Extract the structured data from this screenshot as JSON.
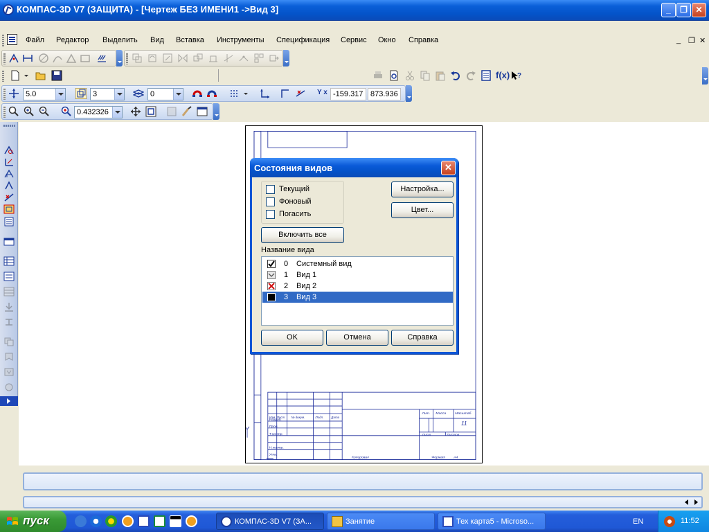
{
  "window": {
    "title": "КОМПАС-3D V7 (ЗАЩИТА) - [Чертеж БЕЗ ИМЕНИ1 ->Вид 3]",
    "minimize": "_",
    "maximize": "❐",
    "close": "✕"
  },
  "menu": {
    "items": [
      "Файл",
      "Редактор",
      "Выделить",
      "Вид",
      "Вставка",
      "Инструменты",
      "Спецификация",
      "Сервис",
      "Окно",
      "Справка"
    ],
    "mdi_minimize": "_",
    "mdi_restore": "❐",
    "mdi_close": "✕"
  },
  "toolbar": {
    "step": "5.0",
    "layer": "3",
    "style_index": "0",
    "coord_x": "-159.317",
    "coord_y": "873.936",
    "coord_label": "Y x",
    "zoom": "0.432326",
    "fx_label": "f(x)"
  },
  "drawing": {
    "sheet_number": "11",
    "format_label": "Формат",
    "format_value": "A4",
    "copied_label": "Копировал"
  },
  "dialog": {
    "title": "Состояния видов",
    "close": "✕",
    "options": [
      {
        "label": "Текущий",
        "checked": false
      },
      {
        "label": "Фоновый",
        "checked": false
      },
      {
        "label": "Погасить",
        "checked": false
      }
    ],
    "settings_button": "Настройка...",
    "color_button": "Цвет...",
    "enable_all_button": "Включить все",
    "list_header": "Название вида",
    "views": [
      {
        "num": "0",
        "name": "Системный вид",
        "state": "visible",
        "selected": false
      },
      {
        "num": "1",
        "name": "Вид 1",
        "state": "background",
        "selected": false
      },
      {
        "num": "2",
        "name": "Вид 2",
        "state": "hidden",
        "selected": false
      },
      {
        "num": "3",
        "name": "Вид 3",
        "state": "current",
        "selected": true
      }
    ],
    "ok_button": "OK",
    "cancel_button": "Отмена",
    "help_button": "Справка"
  },
  "taskbar": {
    "start_label": "пуск",
    "tasks": [
      {
        "label": "КОМПАС-3D V7 (ЗА...",
        "active": true
      },
      {
        "label": "Занятие",
        "active": false
      },
      {
        "label": "Тех карта5 - Microso...",
        "active": false
      }
    ],
    "language": "EN",
    "clock": "11:52"
  }
}
